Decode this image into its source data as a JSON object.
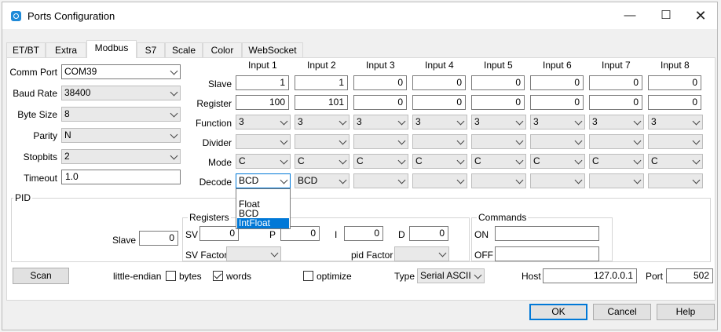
{
  "window": {
    "title": "Ports Configuration"
  },
  "tabs": [
    {
      "label": "ET/BT"
    },
    {
      "label": "Extra"
    },
    {
      "label": "Modbus",
      "active": true
    },
    {
      "label": "S7"
    },
    {
      "label": "Scale"
    },
    {
      "label": "Color"
    },
    {
      "label": "WebSocket"
    }
  ],
  "serial": {
    "comm_port": {
      "label": "Comm Port",
      "value": "COM39"
    },
    "baud_rate": {
      "label": "Baud Rate",
      "value": "38400"
    },
    "byte_size": {
      "label": "Byte Size",
      "value": "8"
    },
    "parity": {
      "label": "Parity",
      "value": "N"
    },
    "stopbits": {
      "label": "Stopbits",
      "value": "2"
    },
    "timeout": {
      "label": "Timeout",
      "value": "1.0"
    }
  },
  "grid": {
    "row_labels": {
      "slave": "Slave",
      "register": "Register",
      "function": "Function",
      "divider": "Divider",
      "mode": "Mode",
      "decode": "Decode"
    },
    "inputs": [
      {
        "header": "Input 1",
        "slave": "1",
        "register": "100",
        "function": "3",
        "divider": "",
        "mode": "C",
        "decode": "BCD"
      },
      {
        "header": "Input 2",
        "slave": "1",
        "register": "101",
        "function": "3",
        "divider": "",
        "mode": "C",
        "decode": "BCD"
      },
      {
        "header": "Input 3",
        "slave": "0",
        "register": "0",
        "function": "3",
        "divider": "",
        "mode": "C",
        "decode": ""
      },
      {
        "header": "Input 4",
        "slave": "0",
        "register": "0",
        "function": "3",
        "divider": "",
        "mode": "C",
        "decode": ""
      },
      {
        "header": "Input 5",
        "slave": "0",
        "register": "0",
        "function": "3",
        "divider": "",
        "mode": "C",
        "decode": ""
      },
      {
        "header": "Input 6",
        "slave": "0",
        "register": "0",
        "function": "3",
        "divider": "",
        "mode": "C",
        "decode": ""
      },
      {
        "header": "Input 7",
        "slave": "0",
        "register": "0",
        "function": "3",
        "divider": "",
        "mode": "C",
        "decode": ""
      },
      {
        "header": "Input 8",
        "slave": "0",
        "register": "0",
        "function": "3",
        "divider": "",
        "mode": "C",
        "decode": ""
      }
    ],
    "decode_dropdown": {
      "options": [
        "",
        "Float",
        "BCD",
        "IntFloat"
      ],
      "highlighted": "IntFloat"
    }
  },
  "pid": {
    "title": "PID",
    "slave": {
      "label": "Slave",
      "value": "0"
    },
    "registers": {
      "title": "Registers",
      "sv": {
        "label": "SV",
        "value": "0"
      },
      "p": {
        "label": "P",
        "value": "0"
      },
      "i": {
        "label": "I",
        "value": "0"
      },
      "d": {
        "label": "D",
        "value": "0"
      },
      "sv_factor": {
        "label": "SV Factor",
        "value": ""
      },
      "pid_factor": {
        "label": "pid Factor",
        "value": ""
      }
    },
    "commands": {
      "title": "Commands",
      "on": {
        "label": "ON",
        "value": ""
      },
      "off": {
        "label": "OFF",
        "value": ""
      }
    }
  },
  "bottom": {
    "scan_label": "Scan",
    "little_endian_label": "little-endian",
    "bytes_label": "bytes",
    "bytes_checked": false,
    "words_label": "words",
    "words_checked": true,
    "optimize_label": "optimize",
    "optimize_checked": false,
    "type_label": "Type",
    "type_value": "Serial ASCII",
    "host_label": "Host",
    "host_value": "127.0.0.1",
    "port_label": "Port",
    "port_value": "502"
  },
  "dialog_buttons": {
    "ok": "OK",
    "cancel": "Cancel",
    "help": "Help"
  },
  "colors": {
    "accent": "#0078d7",
    "highlight": "#0078d7"
  }
}
